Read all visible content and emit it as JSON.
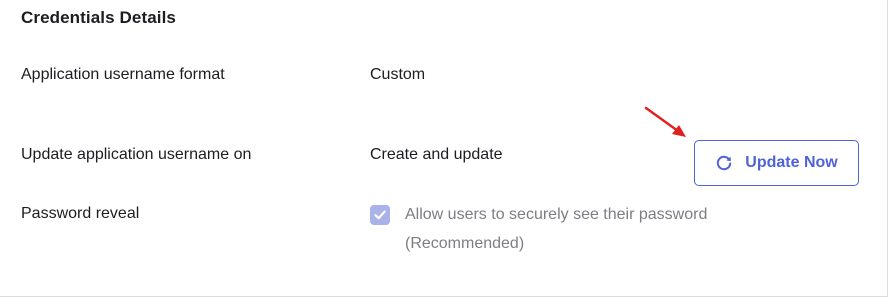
{
  "section": {
    "title": "Credentials Details"
  },
  "rows": [
    {
      "label": "Application username format",
      "value": "Custom"
    },
    {
      "label": "Update application username on",
      "value": "Create and update"
    },
    {
      "label": "Password reveal"
    }
  ],
  "update_button": {
    "label": "Update Now",
    "icon": "refresh-icon",
    "color": "#4f63d8"
  },
  "password_reveal": {
    "checked": true,
    "disabled": true,
    "line1": "Allow users to securely see their password",
    "line2": "(Recommended)"
  },
  "annotation": {
    "icon": "red-arrow-icon",
    "color": "#e02020"
  }
}
